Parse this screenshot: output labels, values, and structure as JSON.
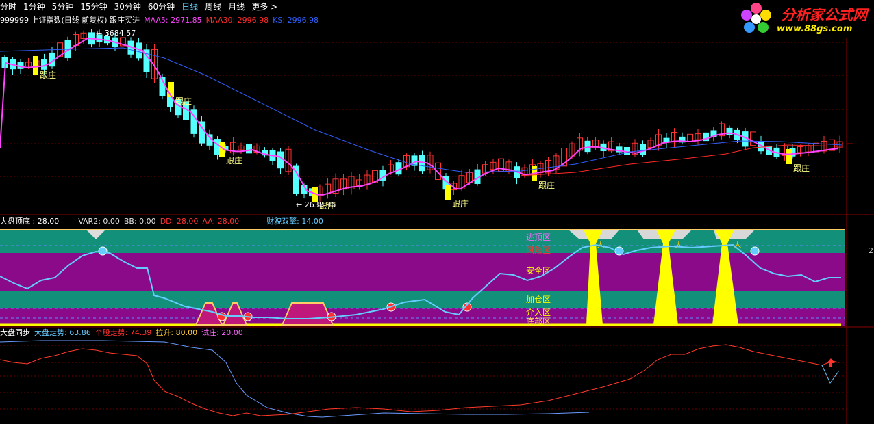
{
  "toolbar": {
    "items": [
      "分时",
      "1分钟",
      "5分钟",
      "15分钟",
      "30分钟",
      "60分钟",
      "日线",
      "周线",
      "月线",
      "更多 >"
    ],
    "active_index": 6
  },
  "logo": {
    "title": "分析家公式网",
    "url": "www.88gs.com"
  },
  "panel1": {
    "title": "999999 上证指数(日线 前复权) 跟庄买进",
    "indicators": [
      {
        "label": "MAA5: 2971.85",
        "color": "#ff44ff"
      },
      {
        "label": "MAA30: 2996.98",
        "color": "#ff2a2a"
      },
      {
        "label": "KS: 2996.98",
        "color": "#3060ff"
      }
    ],
    "high_label": "3684.57",
    "low_label": "2638.96",
    "signal_label": "跟庄",
    "signal_count": 7
  },
  "panel2": {
    "title": "大盘顶底 : 28.00",
    "indicators": [
      {
        "label": "VAR2: 0.00",
        "color": "#e0e0e0"
      },
      {
        "label": "BB: 0.00",
        "color": "#e0e0e0"
      },
      {
        "label": "DD: 28.00",
        "color": "#ff3030"
      },
      {
        "label": "AA: 28.00",
        "color": "#ff3030"
      },
      {
        "label": "财貌双擎: 14.00",
        "color": "#6cf"
      }
    ],
    "zones": [
      "逃顶区",
      "风险区",
      "安全区",
      "加仓区",
      "介入区",
      "底部区"
    ],
    "right_value": "2"
  },
  "panel3": {
    "title": "大盘同步",
    "indicators": [
      {
        "label": "大盘走势: 63.86",
        "color": "#6cf"
      },
      {
        "label": "个股走势: 74.39",
        "color": "#ff3030"
      },
      {
        "label": "拉升: 80.00",
        "color": "#ffcc33"
      },
      {
        "label": "试庄: 20.00",
        "color": "#ff66ff"
      }
    ]
  },
  "colors": {
    "up": "#ff3232",
    "down": "#54ffff",
    "signal": "#ffff00",
    "ma5": "#ff44ff",
    "ma30": "#ff2a2a",
    "ks": "#3060ff",
    "zone_green": "#12907a",
    "zone_purple": "#8a0a8a"
  }
}
